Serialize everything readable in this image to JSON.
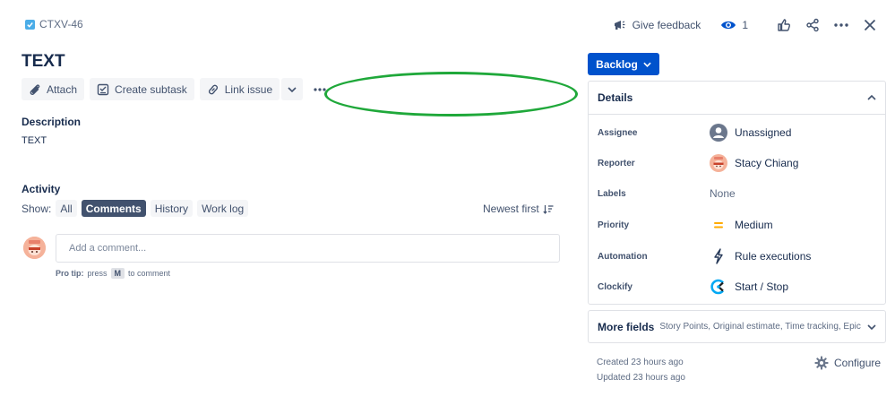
{
  "issue": {
    "key": "CTXV-46",
    "title": "TEXT",
    "description_label": "Description",
    "description_text": "TEXT"
  },
  "top_actions": {
    "feedback_label": "Give feedback",
    "watch_count": "1",
    "icons": [
      "megaphone-icon",
      "eye-icon",
      "thumbs-up-icon",
      "share-icon",
      "more-icon",
      "close-icon"
    ]
  },
  "toolbar": {
    "attach_label": "Attach",
    "create_subtask_label": "Create subtask",
    "link_issue_label": "Link issue"
  },
  "activity": {
    "label": "Activity",
    "show_label": "Show:",
    "filters": [
      "All",
      "Comments",
      "History",
      "Work log"
    ],
    "active_filter": "Comments",
    "sort_label": "Newest first"
  },
  "comment": {
    "placeholder": "Add a comment...",
    "pro_tip_label": "Pro tip:",
    "pro_tip_press": "press",
    "pro_tip_key": "M",
    "pro_tip_suffix": "to comment"
  },
  "status": {
    "label": "Backlog"
  },
  "details": {
    "title": "Details",
    "rows": [
      {
        "label": "Assignee",
        "value": "Unassigned",
        "icon": "user-avatar-icon"
      },
      {
        "label": "Reporter",
        "value": "Stacy Chiang",
        "icon": "reporter-avatar"
      },
      {
        "label": "Labels",
        "value": "None",
        "icon": ""
      },
      {
        "label": "Priority",
        "value": "Medium",
        "icon": "priority-medium-icon"
      },
      {
        "label": "Automation",
        "value": "Rule executions",
        "icon": "lightning-icon"
      },
      {
        "label": "Clockify",
        "value": "Start / Stop",
        "icon": "clockify-icon"
      }
    ]
  },
  "more_fields": {
    "title": "More fields",
    "subtitle": "Story Points, Original estimate, Time tracking, Epic Li..."
  },
  "meta": {
    "created": "Created 23 hours ago",
    "updated": "Updated 23 hours ago",
    "configure_label": "Configure"
  },
  "colors": {
    "primary": "#0052cc",
    "highlight_oval": "#1fa83a",
    "priority_medium": "#ffab00",
    "active_chip": "#42526e"
  }
}
